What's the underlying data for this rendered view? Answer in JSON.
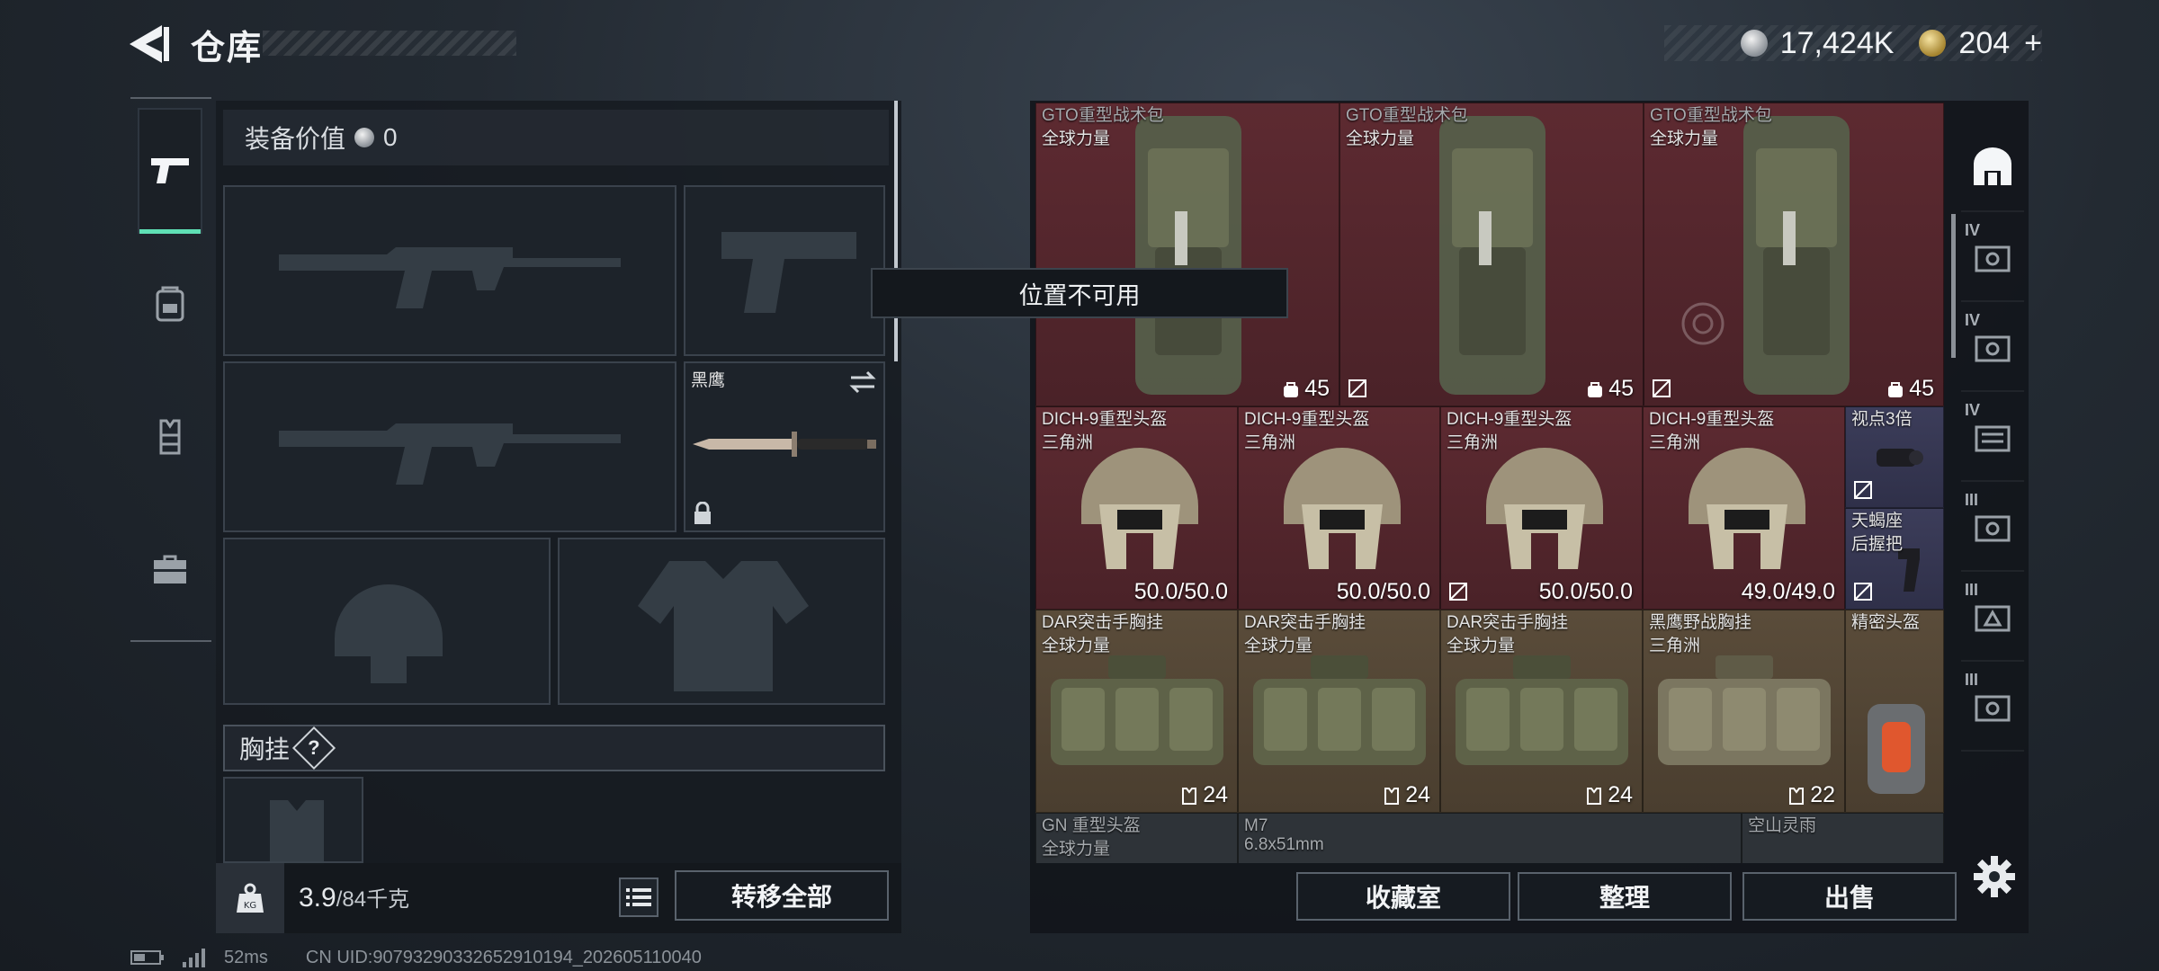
{
  "header": {
    "title": "仓库",
    "currency": {
      "silver": "17,424K",
      "gold": "204",
      "plus": "+"
    }
  },
  "left_tabs": [
    {
      "name": "weapons",
      "icon": "pistol-icon",
      "active": true
    },
    {
      "name": "backpack",
      "icon": "backpack-icon",
      "active": false
    },
    {
      "name": "vest",
      "icon": "vest-icon",
      "active": false
    },
    {
      "name": "toolbox",
      "icon": "toolbox-icon",
      "active": false
    }
  ],
  "equipment": {
    "value_label": "装备价值",
    "value": "0",
    "melee_name": "黑鹰",
    "chest_rig_label": "胸挂",
    "help": "?",
    "weight_current": "3.9",
    "weight_max": "/84千克",
    "transfer_all": "转移全部"
  },
  "tooltip": "位置不可用",
  "stash": {
    "items": [
      {
        "name": "GTO重型战术包",
        "sub": "全球力量",
        "stat": "45"
      },
      {
        "name": "GTO重型战术包",
        "sub": "全球力量",
        "stat": "45"
      },
      {
        "name": "GTO重型战术包",
        "sub": "全球力量",
        "stat": "45"
      },
      {
        "name": "DICH-9重型头盔",
        "sub": "三角洲",
        "stat": "50.0/50.0"
      },
      {
        "name": "DICH-9重型头盔",
        "sub": "三角洲",
        "stat": "50.0/50.0"
      },
      {
        "name": "DICH-9重型头盔",
        "sub": "三角洲",
        "stat": "50.0/50.0"
      },
      {
        "name": "DICH-9重型头盔",
        "sub": "三角洲",
        "stat": "49.0/49.0"
      },
      {
        "name": "视点3倍",
        "sub": "",
        "stat": ""
      },
      {
        "name": "天蝎座",
        "sub": "后握把",
        "stat": ""
      },
      {
        "name": "DAR突击手胸挂",
        "sub": "全球力量",
        "stat": "24"
      },
      {
        "name": "DAR突击手胸挂",
        "sub": "全球力量",
        "stat": "24"
      },
      {
        "name": "DAR突击手胸挂",
        "sub": "全球力量",
        "stat": "24"
      },
      {
        "name": "黑鹰野战胸挂",
        "sub": "三角洲",
        "stat": "22"
      },
      {
        "name": "精密头盔",
        "sub": "",
        "stat": ""
      },
      {
        "name": "GN 重型头盔",
        "sub": "全球力量",
        "stat": ""
      },
      {
        "name": "M7",
        "sub": "6.8x51mm",
        "stat": ""
      },
      {
        "name": "空山灵雨",
        "sub": "",
        "stat": ""
      }
    ],
    "buttons": {
      "collection": "收藏室",
      "organize": "整理",
      "sell": "出售"
    }
  },
  "categories": [
    {
      "icon": "home-shelter-icon",
      "tier": ""
    },
    {
      "icon": "storage-box-icon",
      "tier": "IV"
    },
    {
      "icon": "storage-box-icon",
      "tier": "IV"
    },
    {
      "icon": "storage-box-icon",
      "tier": "IV"
    },
    {
      "icon": "storage-box-icon",
      "tier": "III"
    },
    {
      "icon": "storage-box-icon",
      "tier": "III"
    },
    {
      "icon": "storage-box-icon",
      "tier": "III"
    }
  ],
  "status_bar": {
    "ping": "52ms",
    "uid": "CN UID:907932903326529101​94_202605110040"
  },
  "colors": {
    "accent": "#5fe0b5",
    "rarity_red": "#5d2a31",
    "rarity_yellow": "#5a4c3a",
    "rarity_purple": "#3c3d5a"
  }
}
